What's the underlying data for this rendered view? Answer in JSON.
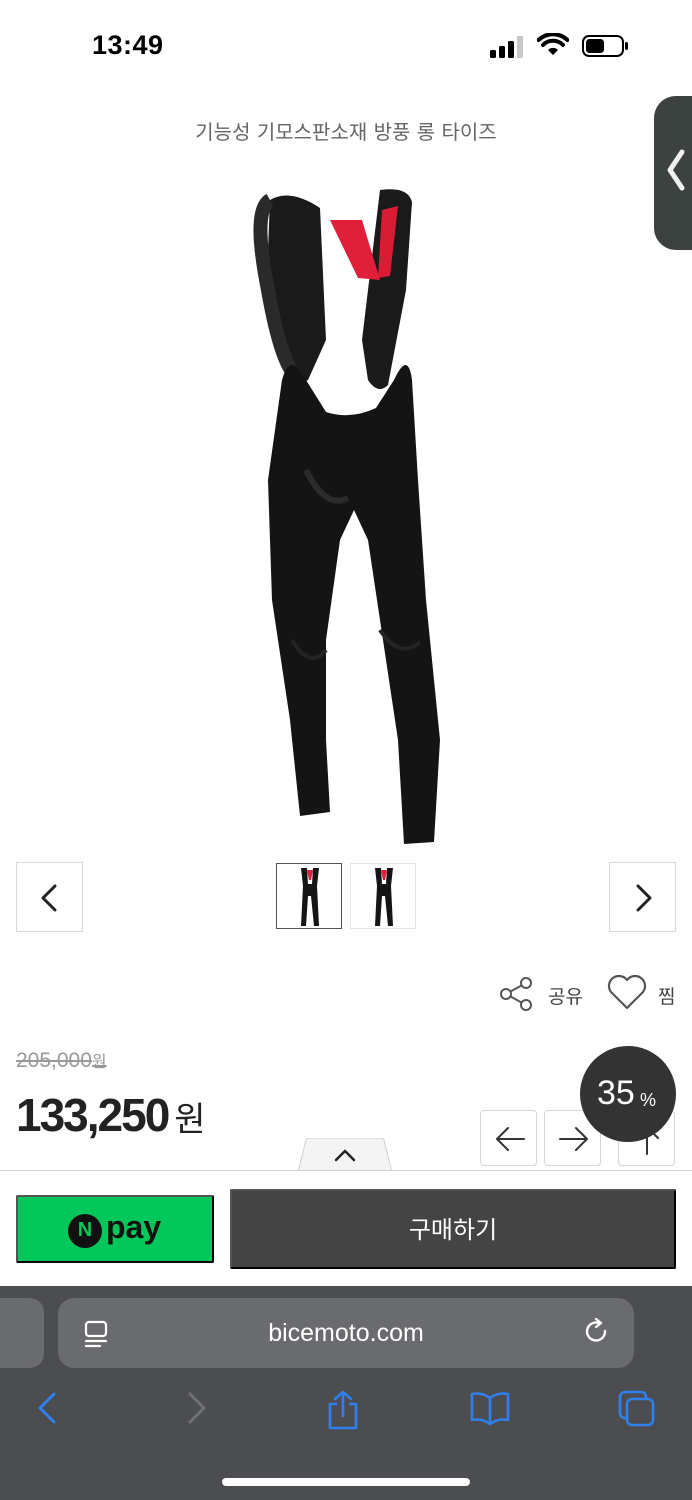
{
  "status_bar": {
    "time": "13:49",
    "icons": [
      "signal-icon",
      "wifi-icon",
      "battery-icon"
    ]
  },
  "product": {
    "title": "기능성 기모스판소재 방풍 롱 타이즈",
    "original_price": "205,000",
    "original_unit": "원",
    "sale_price": "133,250",
    "sale_unit": "원",
    "discount": "35",
    "discount_unit": "%"
  },
  "actions": {
    "share_label": "공유",
    "wish_label": "찜"
  },
  "purchase": {
    "npay_logo": "N",
    "npay_text": "pay",
    "buy_label": "구매하기"
  },
  "browser": {
    "url": "bicemoto.com"
  },
  "colors": {
    "npay_green": "#03c75a",
    "buy_button": "#444444",
    "discount_badge": "#333333",
    "browser_bar": "#4c4d50",
    "accent_blue": "#2f80ed"
  }
}
